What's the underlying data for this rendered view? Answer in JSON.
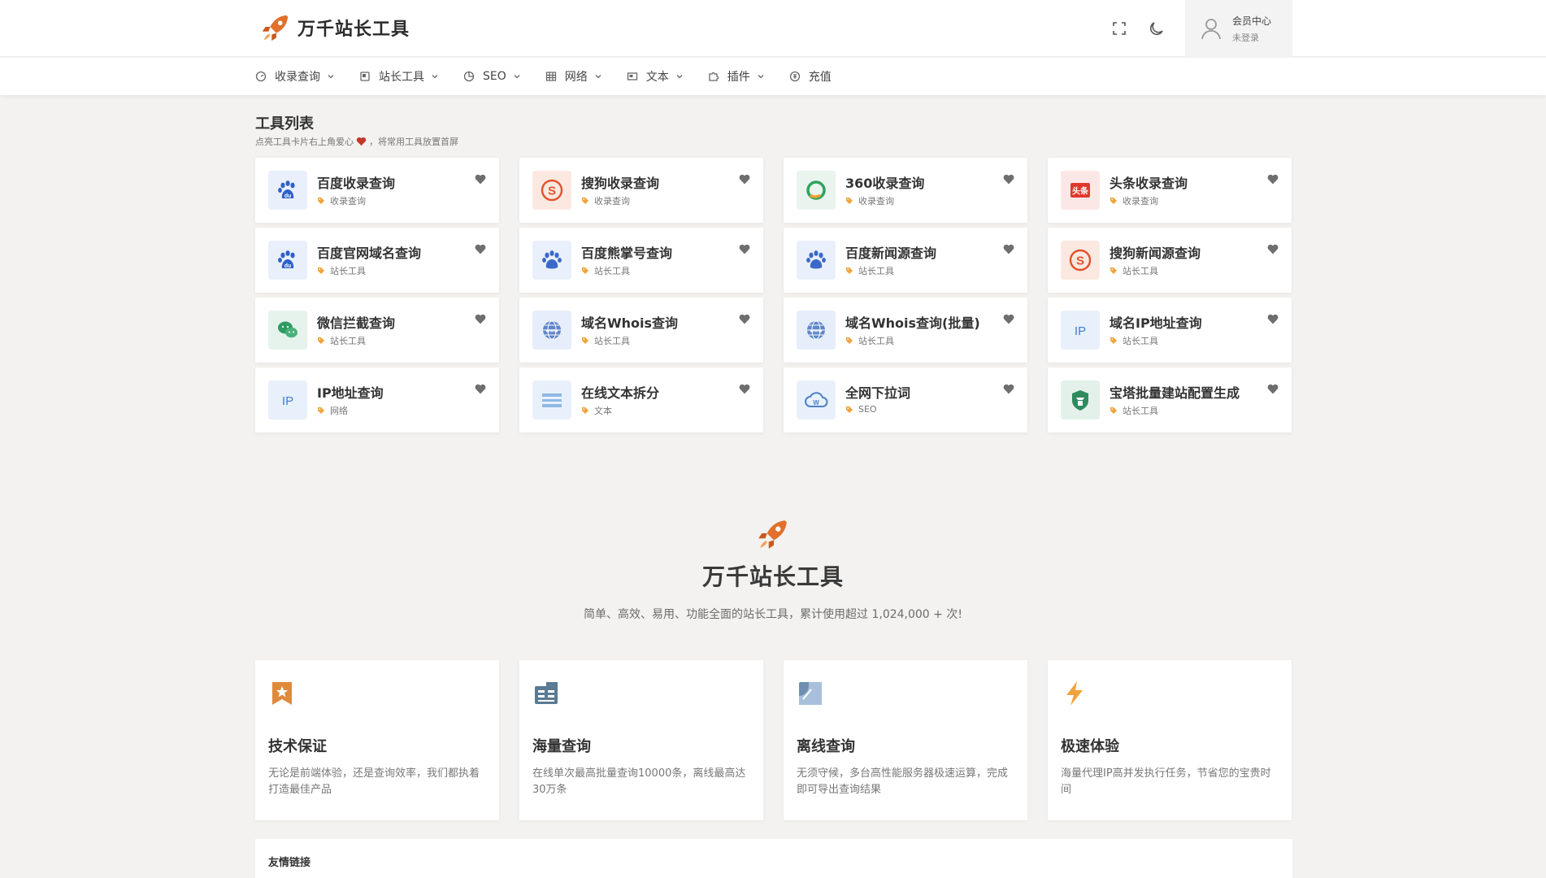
{
  "brand": {
    "name": "万千站长工具",
    "accent": "#e0702c"
  },
  "header": {
    "member_title": "会员中心",
    "member_status": "未登录"
  },
  "nav": [
    {
      "label": "收录查询",
      "icon": "gauge-icon",
      "dropdown": true
    },
    {
      "label": "站长工具",
      "icon": "box-icon",
      "dropdown": true
    },
    {
      "label": "SEO",
      "icon": "pie-icon",
      "dropdown": true
    },
    {
      "label": "网络",
      "icon": "grid-icon",
      "dropdown": true
    },
    {
      "label": "文本",
      "icon": "card-icon",
      "dropdown": true
    },
    {
      "label": "插件",
      "icon": "puzzle-icon",
      "dropdown": true
    },
    {
      "label": "充值",
      "icon": "coin-icon",
      "dropdown": false
    }
  ],
  "tools_section": {
    "title": "工具列表",
    "hint_before": "点亮工具卡片右上角爱心",
    "hint_after": "，将常用工具放置首屏"
  },
  "tools": [
    {
      "name": "百度收录查询",
      "category": "收录查询",
      "icon": "baidu-icon"
    },
    {
      "name": "搜狗收录查询",
      "category": "收录查询",
      "icon": "sogou-icon"
    },
    {
      "name": "360收录查询",
      "category": "收录查询",
      "icon": "360-icon"
    },
    {
      "name": "头条收录查询",
      "category": "收录查询",
      "icon": "toutiao-icon"
    },
    {
      "name": "百度官网域名查询",
      "category": "站长工具",
      "icon": "baidu-icon"
    },
    {
      "name": "百度熊掌号查询",
      "category": "站长工具",
      "icon": "paw-icon"
    },
    {
      "name": "百度新闻源查询",
      "category": "站长工具",
      "icon": "paw-icon"
    },
    {
      "name": "搜狗新闻源查询",
      "category": "站长工具",
      "icon": "sogou-icon"
    },
    {
      "name": "微信拦截查询",
      "category": "站长工具",
      "icon": "wechat-icon"
    },
    {
      "name": "域名Whois查询",
      "category": "站长工具",
      "icon": "www-icon"
    },
    {
      "name": "域名Whois查询(批量)",
      "category": "站长工具",
      "icon": "www-icon"
    },
    {
      "name": "域名IP地址查询",
      "category": "站长工具",
      "icon": "ip-icon"
    },
    {
      "name": "IP地址查询",
      "category": "网络",
      "icon": "ip-icon"
    },
    {
      "name": "在线文本拆分",
      "category": "文本",
      "icon": "text-split-icon"
    },
    {
      "name": "全网下拉词",
      "category": "SEO",
      "icon": "cloud-icon"
    },
    {
      "name": "宝塔批量建站配置生成",
      "category": "站长工具",
      "icon": "bt-icon"
    }
  ],
  "hero": {
    "title": "万千站长工具",
    "subtitle": "简单、高效、易用、功能全面的站长工具，累计使用超过 1,024,000 + 次!"
  },
  "features": [
    {
      "title": "技术保证",
      "desc": "无论是前端体验，还是查询效率，我们都执着打造最佳产品",
      "icon": "award-icon"
    },
    {
      "title": "海量查询",
      "desc": "在线单次最高批量查询10000条，离线最高达30万条",
      "icon": "dashboard-icon"
    },
    {
      "title": "离线查询",
      "desc": "无须守候，多台高性能服务器极速运算，完成即可导出查询结果",
      "icon": "offline-icon"
    },
    {
      "title": "极速体验",
      "desc": "海量代理IP高并发执行任务，节省您的宝贵时间",
      "icon": "bolt-icon"
    }
  ],
  "links": {
    "title": "友情链接"
  }
}
